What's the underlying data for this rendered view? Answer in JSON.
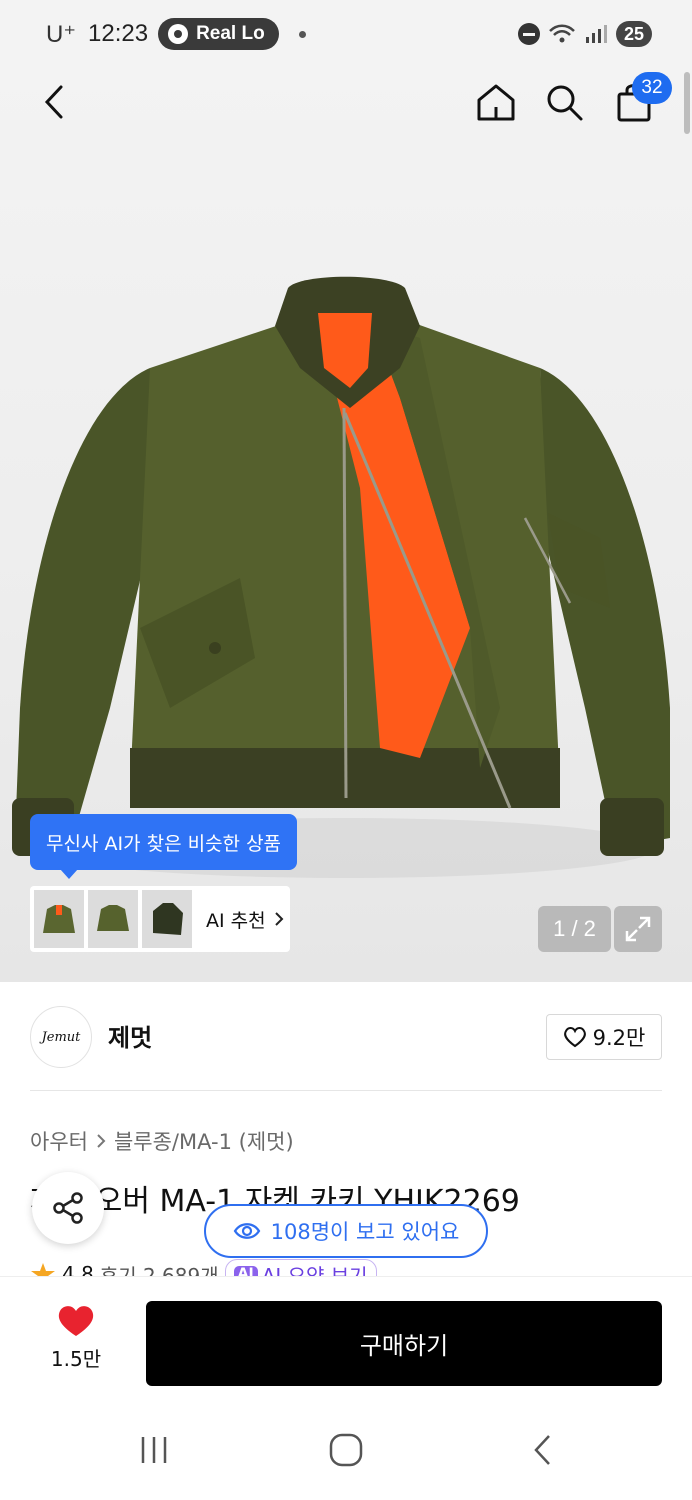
{
  "status_bar": {
    "carrier": "U⁺",
    "time": "12:23",
    "live_pill": "Real Lo",
    "battery": "25"
  },
  "header": {
    "cart_count": "32"
  },
  "product_image": {
    "ai_tooltip": "무신사 AI가 찾은 비슷한 상품",
    "ai_recommend_label": "AI 추천",
    "pager": "1 / 2",
    "colors": {
      "jacket": "#4e5a2a",
      "lining": "#ff5a1a"
    }
  },
  "brand": {
    "logo_text": "Jemut",
    "name": "제멋",
    "likes": "9.2만"
  },
  "product": {
    "breadcrumb": [
      "아우터",
      "블루종/MA-1 (제멋)"
    ],
    "title": "제멋 오버 MA-1 자켓 카키 YHJK2269",
    "rating": "4.8",
    "reviews": "후기 2,689개",
    "ai_badge": "AI",
    "ai_summary": "AI 요약 보기",
    "viewing": "108명이 보고 있어요"
  },
  "bottom_bar": {
    "wish_count": "1.5만",
    "buy_label": "구매하기",
    "accent": "#e8232f"
  }
}
